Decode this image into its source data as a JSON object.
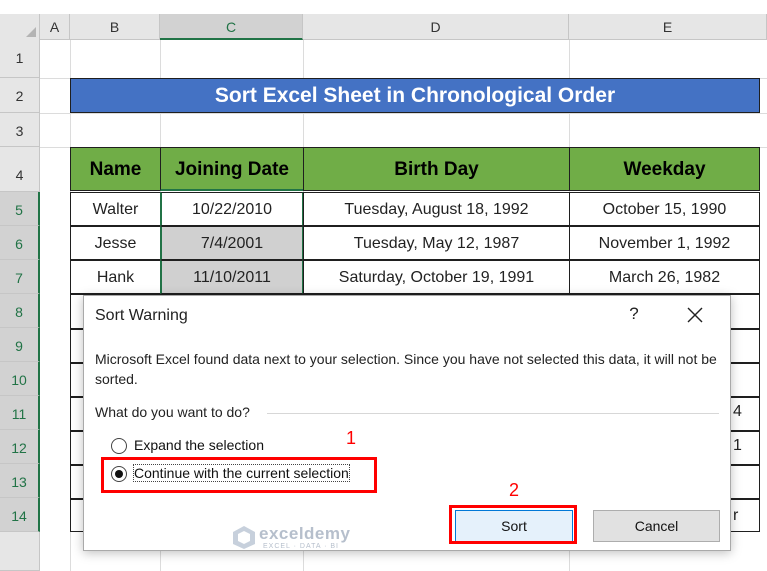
{
  "spreadsheet": {
    "columns": [
      "A",
      "B",
      "C",
      "D",
      "E"
    ],
    "rows": [
      "1",
      "2",
      "3",
      "4",
      "5",
      "6",
      "7",
      "8",
      "9",
      "10",
      "11",
      "12",
      "13",
      "14"
    ],
    "title": "Sort Excel Sheet in Chronological Order",
    "headers": [
      "Name",
      "Joining Date",
      "Birth Day",
      "Weekday"
    ],
    "data": [
      [
        "Walter",
        "10/22/2010",
        "Tuesday, August 18, 1992",
        "October 15, 1990"
      ],
      [
        "Jesse",
        "7/4/2001",
        "Tuesday, May 12, 1987",
        "November 1, 1992"
      ],
      [
        "Hank",
        "11/10/2011",
        "Saturday, October 19, 1991",
        "March 26, 1982"
      ]
    ],
    "partial_cells": {
      "row11_e": "4",
      "row12_e": "1",
      "row14_e": "r"
    },
    "colors": {
      "title_bg": "#4472c4",
      "header_bg": "#70ad47",
      "selected": "#217346"
    }
  },
  "dialog": {
    "title": "Sort Warning",
    "help": "?",
    "message": "Microsoft Excel found data next to your selection.  Since you have not selected this data, it will not be sorted.",
    "question": "What do you want to do?",
    "options": [
      {
        "label": "Expand the selection",
        "selected": false
      },
      {
        "label": "Continue with the current selection",
        "selected": true
      }
    ],
    "sort_button": "Sort",
    "cancel_button": "Cancel"
  },
  "annotations": {
    "step1": "1",
    "step2": "2",
    "color": "#ff0000"
  },
  "watermark": {
    "name": "exceldemy",
    "sub": "EXCEL · DATA · BI"
  }
}
